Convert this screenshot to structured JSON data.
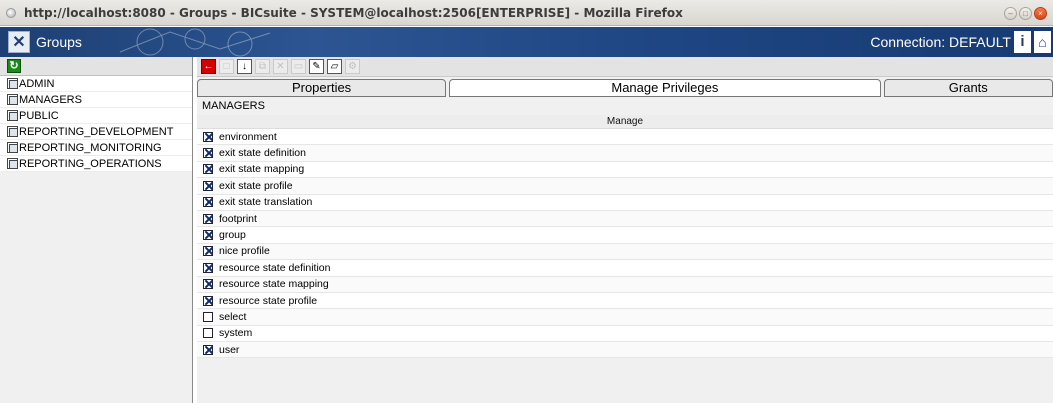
{
  "window": {
    "title": "http://localhost:8080 - Groups - BICsuite - SYSTEM@localhost:2506[ENTERPRISE] - Mozilla Firefox"
  },
  "app": {
    "title": "Groups",
    "connection": "Connection: DEFAULT",
    "info_icon": "info-icon",
    "home_icon": "home-icon"
  },
  "sidebar": {
    "items": [
      {
        "label": "ADMIN"
      },
      {
        "label": "MANAGERS"
      },
      {
        "label": "PUBLIC"
      },
      {
        "label": "REPORTING_DEVELOPMENT"
      },
      {
        "label": "REPORTING_MONITORING"
      },
      {
        "label": "REPORTING_OPERATIONS"
      }
    ]
  },
  "tabs": [
    {
      "label": "Properties"
    },
    {
      "label": "Manage Privileges"
    },
    {
      "label": "Grants"
    }
  ],
  "main": {
    "group_name": "MANAGERS",
    "column_header": "Manage",
    "privileges": [
      {
        "label": "environment",
        "checked": true
      },
      {
        "label": "exit state definition",
        "checked": true
      },
      {
        "label": "exit state mapping",
        "checked": true
      },
      {
        "label": "exit state profile",
        "checked": true
      },
      {
        "label": "exit state translation",
        "checked": true
      },
      {
        "label": "footprint",
        "checked": true
      },
      {
        "label": "group",
        "checked": true
      },
      {
        "label": "nice profile",
        "checked": true
      },
      {
        "label": "resource state definition",
        "checked": true
      },
      {
        "label": "resource state mapping",
        "checked": true
      },
      {
        "label": "resource state profile",
        "checked": true
      },
      {
        "label": "select",
        "checked": false
      },
      {
        "label": "system",
        "checked": false
      },
      {
        "label": "user",
        "checked": true
      }
    ]
  }
}
